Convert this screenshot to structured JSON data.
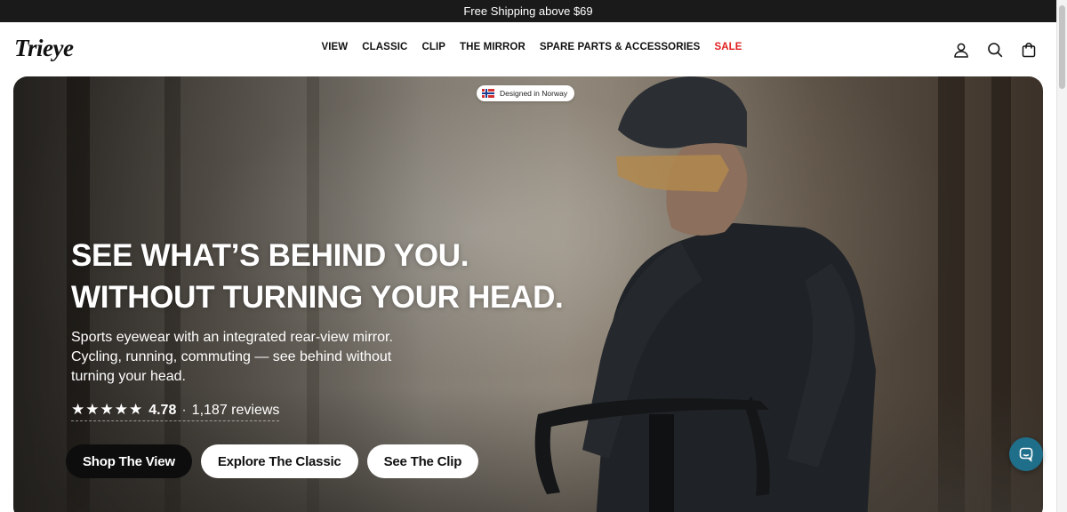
{
  "announcement": {
    "text": "Free Shipping above $69"
  },
  "header": {
    "logo": "Trieye",
    "nav": [
      {
        "label": "VIEW",
        "highlight": false
      },
      {
        "label": "CLASSIC",
        "highlight": false
      },
      {
        "label": "CLIP",
        "highlight": false
      },
      {
        "label": "THE MIRROR",
        "highlight": false
      },
      {
        "label": "SPARE PARTS & ACCESSORIES",
        "highlight": false
      },
      {
        "label": "SALE",
        "highlight": true
      }
    ],
    "icons": [
      "account-icon",
      "search-icon",
      "cart-icon"
    ]
  },
  "hero": {
    "badge": "Designed in Norway",
    "headline_line1": "SEE WHAT’S BEHIND YOU.",
    "headline_line2": "WITHOUT TURNING YOUR HEAD.",
    "subtext": "Sports eyewear with an integrated rear-view mirror. Cycling, running, commuting — see behind without turning your head.",
    "rating": {
      "stars": "★★★★★",
      "score": "4.78",
      "separator": "·",
      "reviews": "1,187 reviews"
    },
    "buttons": [
      {
        "label": "Shop The View",
        "style": "dark"
      },
      {
        "label": "Explore The Classic",
        "style": "light"
      },
      {
        "label": "See The Clip",
        "style": "light"
      }
    ]
  },
  "colors": {
    "sale": "#e02020",
    "announce_bg": "#1a1a1a",
    "chat": "#1f6f8b"
  }
}
